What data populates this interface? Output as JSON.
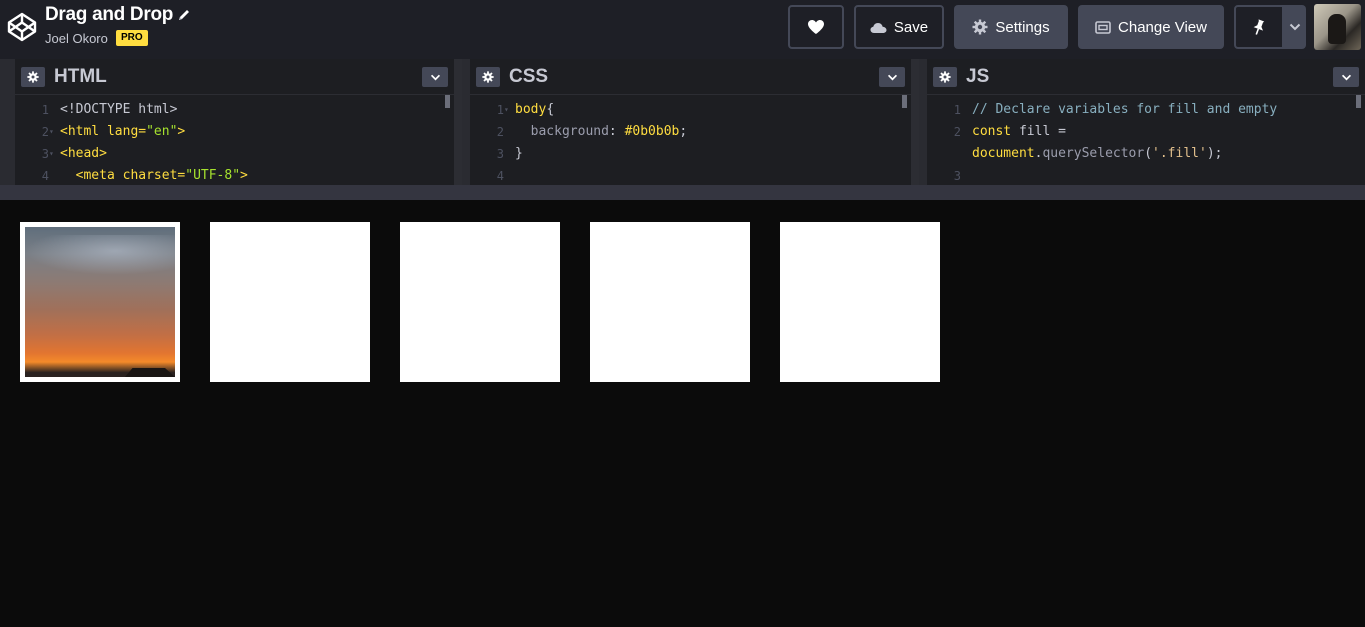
{
  "header": {
    "title": "Drag and Drop",
    "author": "Joel Okoro",
    "badge": "PRO",
    "save_label": "Save",
    "settings_label": "Settings",
    "change_view_label": "Change View"
  },
  "editors": {
    "html": {
      "title": "HTML",
      "lines": [
        {
          "n": "1",
          "parts": [
            {
              "t": "<!DOCTYPE html>",
              "c": "t-plain"
            }
          ]
        },
        {
          "n": "2",
          "fold": true,
          "parts": [
            {
              "t": "<html ",
              "c": "t-tag"
            },
            {
              "t": "lang=",
              "c": "t-attr"
            },
            {
              "t": "\"en\"",
              "c": "t-str"
            },
            {
              "t": ">",
              "c": "t-tag"
            }
          ]
        },
        {
          "n": "3",
          "fold": true,
          "parts": [
            {
              "t": "<head>",
              "c": "t-tag"
            }
          ]
        },
        {
          "n": "4",
          "parts": [
            {
              "t": "  <meta ",
              "c": "t-tag"
            },
            {
              "t": "charset=",
              "c": "t-attr"
            },
            {
              "t": "\"UTF-8\"",
              "c": "t-str"
            },
            {
              "t": ">",
              "c": "t-tag"
            }
          ]
        }
      ]
    },
    "css": {
      "title": "CSS",
      "lines": [
        {
          "n": "1",
          "fold": true,
          "parts": [
            {
              "t": "body",
              "c": "t-tag"
            },
            {
              "t": "{",
              "c": "t-plain"
            }
          ]
        },
        {
          "n": "2",
          "parts": [
            {
              "t": "  background",
              "c": "t-prop"
            },
            {
              "t": ": ",
              "c": "t-plain"
            },
            {
              "t": "#0b0b0b",
              "c": "t-val"
            },
            {
              "t": ";",
              "c": "t-plain"
            }
          ]
        },
        {
          "n": "3",
          "parts": [
            {
              "t": "}",
              "c": "t-plain"
            }
          ]
        },
        {
          "n": "4",
          "parts": []
        }
      ]
    },
    "js": {
      "title": "JS",
      "lines": [
        {
          "n": "1",
          "parts": [
            {
              "t": "// Declare variables for fill and empty",
              "c": "t-cm"
            }
          ]
        },
        {
          "n": "2",
          "parts": [
            {
              "t": "const ",
              "c": "t-kw"
            },
            {
              "t": "fill",
              "c": "t-plain"
            },
            {
              "t": " =",
              "c": "t-plain"
            }
          ]
        },
        {
          "n": "",
          "parts": [
            {
              "t": "document",
              "c": "t-val"
            },
            {
              "t": ".",
              "c": "t-plain"
            },
            {
              "t": "querySelector",
              "c": "t-prop"
            },
            {
              "t": "(",
              "c": "t-plain"
            },
            {
              "t": "'.fill'",
              "c": "t-str2"
            },
            {
              "t": ");",
              "c": "t-plain"
            }
          ]
        },
        {
          "n": "3",
          "parts": []
        }
      ]
    }
  },
  "preview": {
    "boxes": [
      {
        "kind": "fill"
      },
      {
        "kind": "empty"
      },
      {
        "kind": "empty"
      },
      {
        "kind": "empty"
      },
      {
        "kind": "empty"
      }
    ]
  },
  "icons": {
    "logo": "codepen-logo-icon",
    "pencil": "pencil-icon",
    "heart": "heart-icon",
    "cloud": "cloud-icon",
    "gear": "gear-icon",
    "view": "change-view-icon",
    "pin": "pin-icon",
    "chevron": "chevron-down-icon"
  },
  "colors": {
    "header_bg": "#1e1f26",
    "button_bg": "#444857",
    "badge": "#ffdd40",
    "preview_bg": "#0b0b0b"
  }
}
